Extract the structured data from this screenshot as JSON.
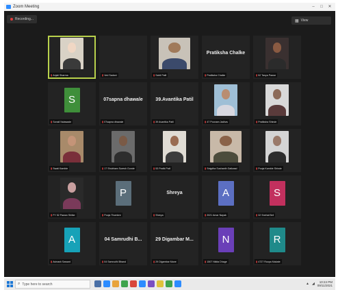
{
  "window": {
    "title": "Zoom Meeting",
    "recording_label": "Recording...",
    "view_label": "View"
  },
  "colors": {
    "active_speaker_border": "#b9d24c",
    "muted_mic": "#e04040",
    "background": "#1b1b1b"
  },
  "participants": [
    {
      "id": "p1",
      "tag": "Anjali Sharma",
      "type": "video",
      "active": true,
      "palette": [
        "#d9d2c6",
        "#f0d7c4",
        "#3a3a3a"
      ]
    },
    {
      "id": "p2",
      "tag": "Ved Sadani",
      "type": "blank"
    },
    {
      "id": "p3",
      "tag": "Sahil Patil",
      "type": "video",
      "wide": true,
      "palette": [
        "#c8c2b8",
        "#a07a5a",
        "#3b4a6b"
      ]
    },
    {
      "id": "p4",
      "tag": "Pratiksha Chalke",
      "type": "name",
      "display_name": "Pratiksha Chalke"
    },
    {
      "id": "p5",
      "tag": "52 Tanya Pawar",
      "type": "video",
      "palette": [
        "#3a3030",
        "#8a5a42",
        "#2b2b2b"
      ]
    },
    {
      "id": "p6",
      "tag": "Sonali Nalawade",
      "type": "avatar",
      "letter": "S",
      "color": "#3f8f3a"
    },
    {
      "id": "p7",
      "tag": "07sapna dhawale",
      "type": "name",
      "display_name": "07sapna dhawale"
    },
    {
      "id": "p8",
      "tag": "39 Avantika Patil",
      "type": "name",
      "display_name": "39.Avantika Patil"
    },
    {
      "id": "p9",
      "tag": "47 Poonam Jadhav",
      "type": "video",
      "palette": [
        "#9fbfd6",
        "#b98d72",
        "#d8d8e0"
      ]
    },
    {
      "id": "p10",
      "tag": "Pratiksha Shinde",
      "type": "video",
      "palette": [
        "#d9d9d9",
        "#8c6a58",
        "#5a3b3b"
      ]
    },
    {
      "id": "p11",
      "tag": "Swati Kamble",
      "type": "video",
      "palette": [
        "#a88a6a",
        "#c49478",
        "#7a2f3a"
      ]
    },
    {
      "id": "p12",
      "tag": "17 Shubham Suresh Gunde",
      "type": "video",
      "palette": [
        "#6b6b6b",
        "#7a5a46",
        "#2d2d2d"
      ]
    },
    {
      "id": "p13",
      "tag": "53 Pratik Patil",
      "type": "video",
      "palette": [
        "#e0dcd4",
        "#9a6c52",
        "#3c3c3c"
      ]
    },
    {
      "id": "p14",
      "tag": "Snigdha Sushanth Gaikwad",
      "type": "video",
      "wide": true,
      "palette": [
        "#c8b9a8",
        "#8a6248",
        "#4c4c3c"
      ]
    },
    {
      "id": "p15",
      "tag": "Pooja Kamble Shinde",
      "type": "video",
      "palette": [
        "#d4d4d4",
        "#9a7a6a",
        "#2c2c2c"
      ]
    },
    {
      "id": "p16",
      "tag": "FY 52 Pawan Shilke",
      "type": "video",
      "palette": [
        "#2a2a2a",
        "#c9a0a0",
        "#7a3a5a"
      ]
    },
    {
      "id": "p17",
      "tag": "Pooja Thombre",
      "type": "avatar",
      "letter": "P",
      "color": "#5b6e7a"
    },
    {
      "id": "p18",
      "tag": "Shreya",
      "type": "name",
      "display_name": "Shreya"
    },
    {
      "id": "p19",
      "tag": "2021 Amar Nayak",
      "type": "avatar",
      "letter": "A",
      "color": "#5c6fc2"
    },
    {
      "id": "p20",
      "tag": "32 Snehal Bell",
      "type": "avatar",
      "letter": "S",
      "color": "#c2305e"
    },
    {
      "id": "p21",
      "tag": "Avinash Sawant",
      "type": "avatar",
      "letter": "A",
      "color": "#17a2b8"
    },
    {
      "id": "p22",
      "tag": "04 Samrudhi Bhand",
      "type": "name",
      "display_name": "04 Samrudhi B..."
    },
    {
      "id": "p23",
      "tag": "29 Digambar Mane",
      "type": "name",
      "display_name": "29 Digambar M..."
    },
    {
      "id": "p24",
      "tag": "1507 Nikita Dhage",
      "type": "avatar",
      "letter": "N",
      "color": "#6a3fb8"
    },
    {
      "id": "p25",
      "tag": "4727 Roopa Makate",
      "type": "avatar",
      "letter": "R",
      "color": "#1f8a8a"
    }
  ],
  "taskbar": {
    "search_placeholder": "Type here to search",
    "time": "10:24 PM",
    "date": "09/11/2021",
    "icon_colors": [
      "#4a6fa5",
      "#2d8cff",
      "#e8a33c",
      "#3fa34d",
      "#d9463b",
      "#2d8cff",
      "#7a4fc2",
      "#e0c23c",
      "#3fa34d",
      "#2d8cff"
    ]
  }
}
